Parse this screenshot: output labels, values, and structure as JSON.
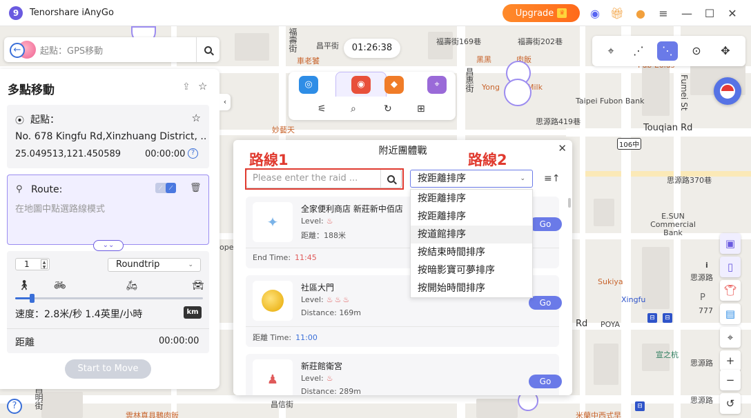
{
  "app": {
    "title": "Tenorshare iAnyGo",
    "upgrade_label": "Upgrade"
  },
  "colors": {
    "accent": "#6a7ae8",
    "brand_purple": "#6a5ae0",
    "upgrade_orange": "#ff7a22",
    "annotation_red": "#e03a2f"
  },
  "start_search": {
    "placeholder": "起點：GPS移動"
  },
  "panel": {
    "title": "多點移動",
    "start": {
      "label": "起點：",
      "address": "No. 678 Kingfu Rd,Xinzhuang District, ...",
      "coords": "25.049513,121.450589",
      "time": "00:00:00"
    },
    "route": {
      "label": "Route:",
      "hint": "在地圖中點選路線模式"
    },
    "settings": {
      "count": "1",
      "mode": "Roundtrip",
      "speed_text": "速度：2.8米/秒 1.4英里/小時",
      "speed_level": 0.09,
      "unit": "km",
      "distance_label": "距離",
      "distance_time": "00:00:00"
    },
    "start_move_label": "Start to Move"
  },
  "timer": "01:26:38",
  "raid_dialog": {
    "title": "附近團體戰",
    "search_placeholder": "Please enter the raid ...",
    "sort_selected": "按距離排序",
    "sort_options": [
      "按距離排序",
      "按距離排序",
      "按道館排序",
      "按結束時間排序",
      "按暗影寶可夢排序",
      "按開始時間排序"
    ],
    "annotations": {
      "route1": "路線1",
      "route2": "路線2"
    },
    "go_label": "Go",
    "raids": [
      {
        "name": "全家便利商店 新莊新中佰店",
        "level_label": "Level:",
        "eggs": "♨",
        "distance_label": "距離：",
        "distance": "188米",
        "time_label": "End Time:",
        "time": "11:45",
        "time_color": "#e05a5a"
      },
      {
        "name": "社區大門",
        "level_label": "Level:",
        "eggs": "♨♨♨",
        "distance_label": "Distance:",
        "distance": "169m",
        "time_label": "距離 Time:",
        "time": "11:00",
        "time_color": "#3a6fd8"
      },
      {
        "name": "新莊館衛宮",
        "level_label": "Level:",
        "eggs": "♨",
        "distance_label": "Distance:",
        "distance": "289m"
      }
    ]
  },
  "map_labels": {
    "l1": "昌平街",
    "l2": "福壽街169巷",
    "l3": "福壽街202巷",
    "l4": "福壽街",
    "l5": "車老饕",
    "l6": "黑黑",
    "l7": "肉飯",
    "l8": "Yong",
    "l9": "Milk",
    "l10": "Taipei Fubon Bank",
    "l11": "思源路419巷",
    "l12": "Touqian Rd",
    "l13": "106中",
    "l14": "思源路370巷",
    "l15": "E.SUN Commercial Bank",
    "l16": "Sukiya",
    "l17": "Xingfu",
    "l18": "POYA",
    "l19": "Rd",
    "l20": "思源路",
    "l21": "宣之杭",
    "l22": "思源路",
    "l23": "思源路",
    "l24": "777",
    "l25": "昌信街",
    "l26": "雲林真具鵝肉飯",
    "l27": "米蘭中西式早",
    "l28": "妙藝天",
    "l29": "Fumei St",
    "l30": "昌惠街",
    "l31": "ope",
    "l32": "昌明街",
    "l33": "Pub Eolus",
    "l34": "Poke",
    "l35": "P",
    "l36": "i"
  }
}
